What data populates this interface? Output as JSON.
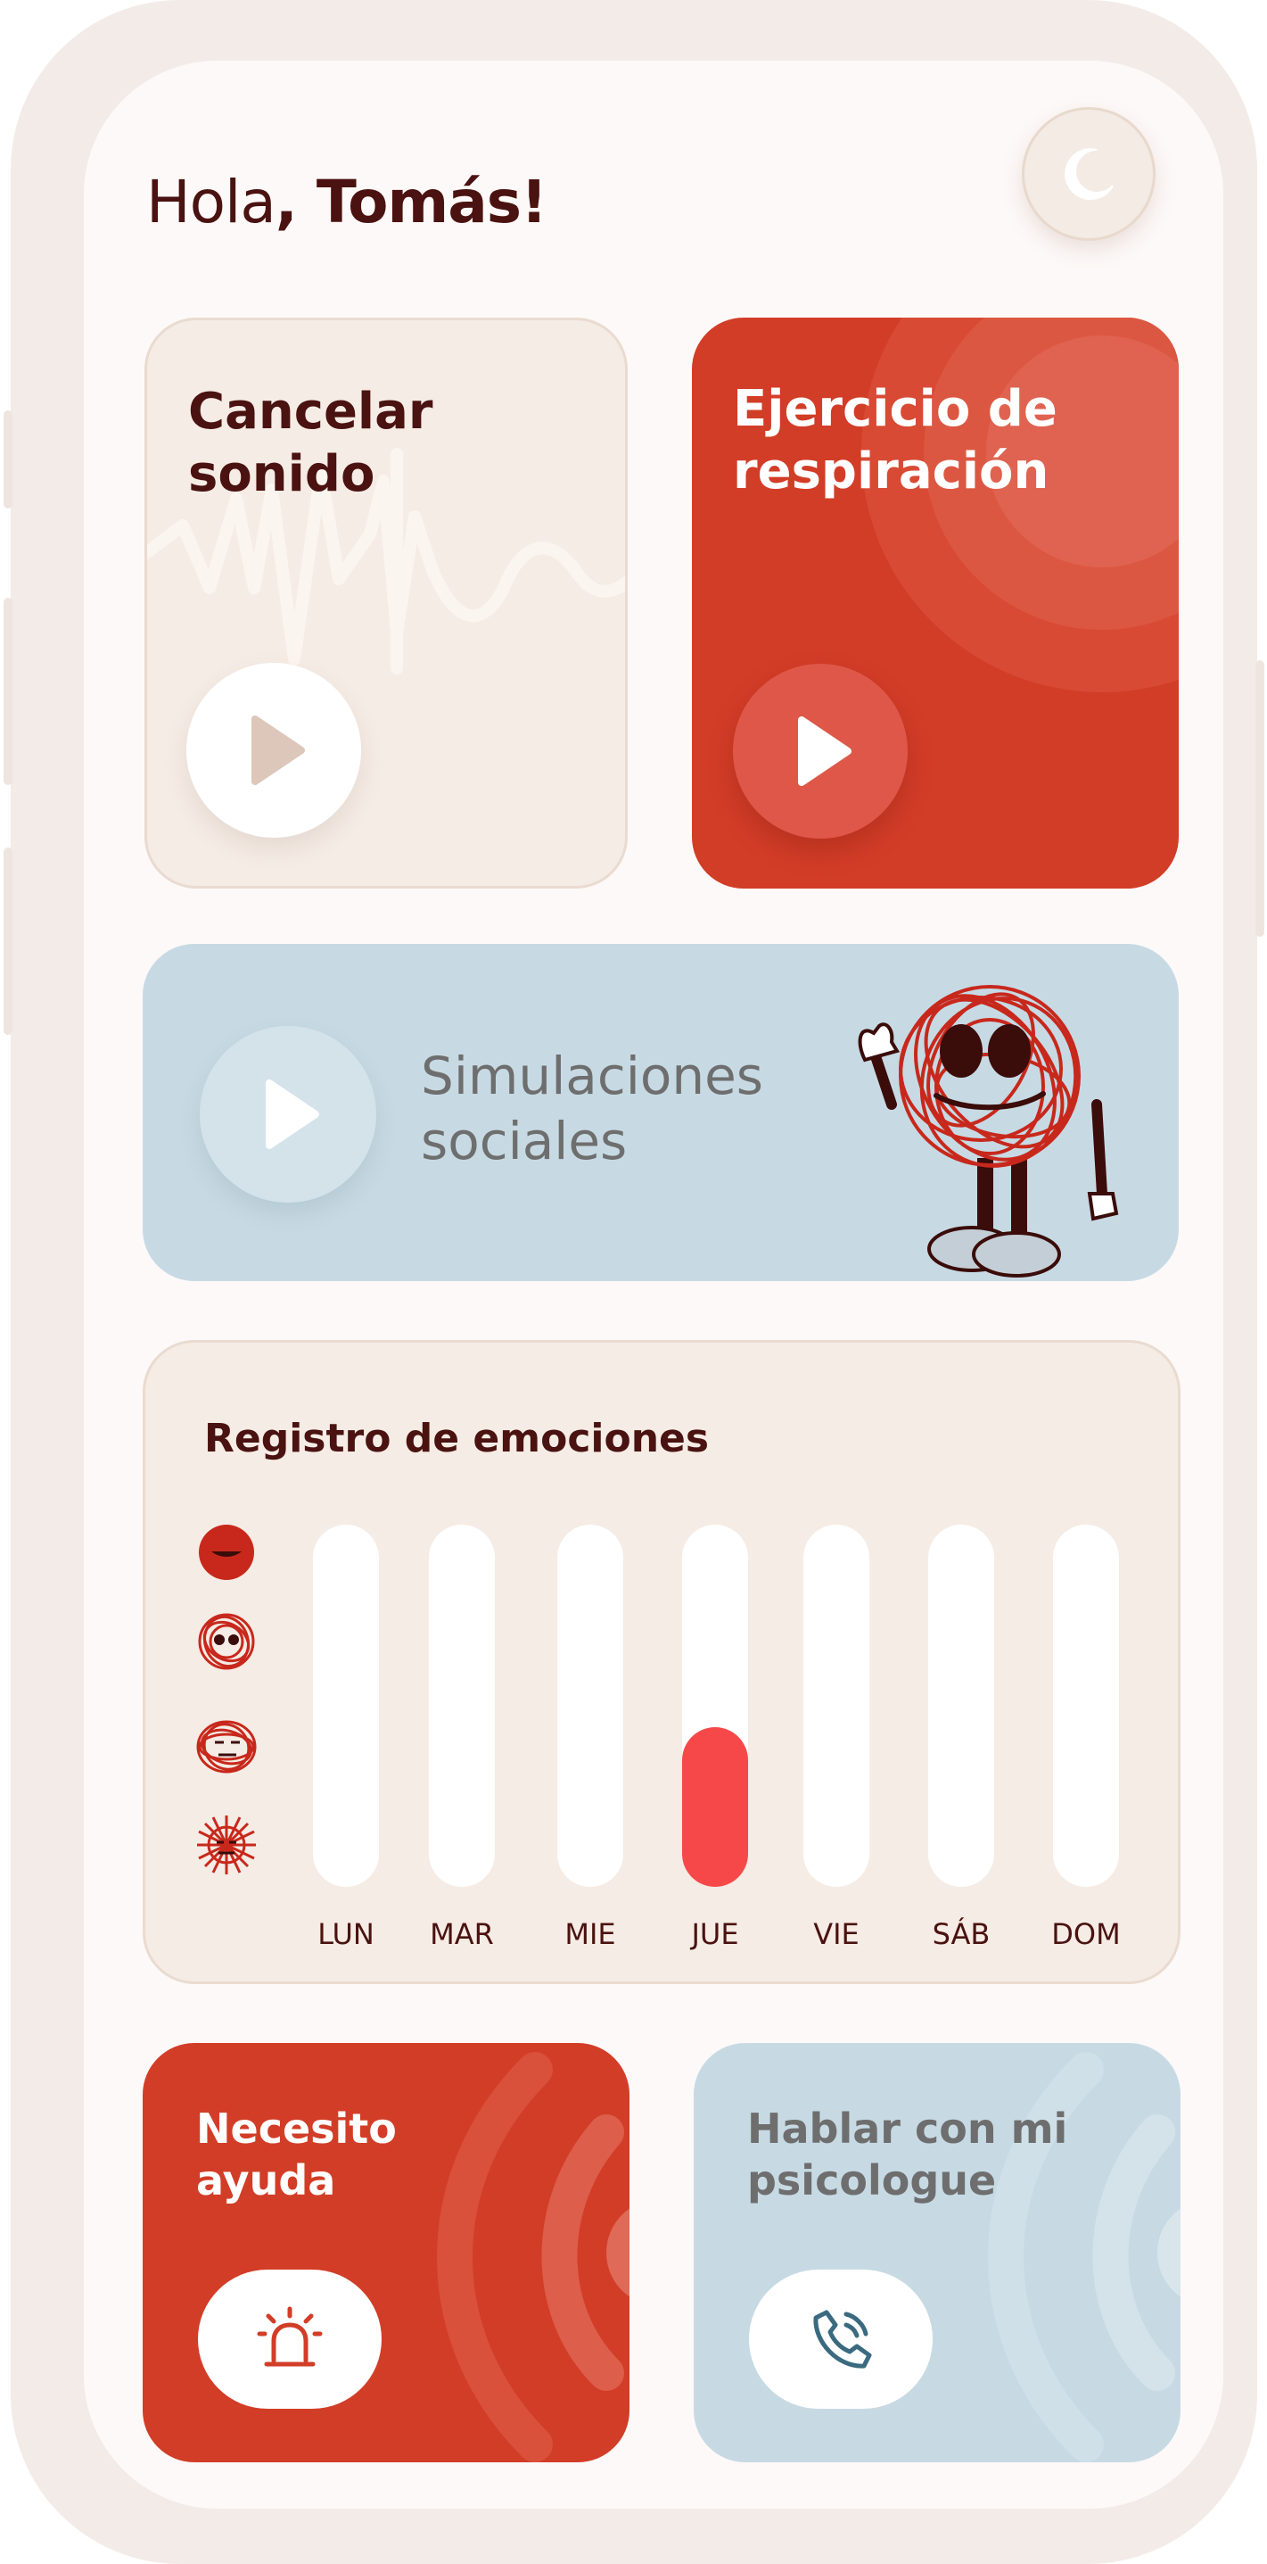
{
  "greeting": {
    "prefix": "Hola",
    "name": ", Tomás!"
  },
  "theme_toggle": {
    "icon": "moon-icon"
  },
  "cards": {
    "cancel_sound": {
      "title": "Cancelar sonido",
      "icon": "play-icon"
    },
    "breathing": {
      "title": "Ejercicio de respiración",
      "icon": "play-icon"
    },
    "social": {
      "title": "Simulaciones sociales",
      "icon": "play-icon"
    },
    "help": {
      "title": "Necesito ayuda",
      "icon": "siren-icon"
    },
    "psychologist": {
      "title": "Hablar con mi psicologue",
      "icon": "phone-icon"
    }
  },
  "emotions": {
    "title": "Registro de emociones",
    "levels": [
      "happy-face-icon",
      "calm-face-icon",
      "uneasy-face-icon",
      "stressed-face-icon"
    ],
    "days": [
      {
        "label": "LUN",
        "level": 0
      },
      {
        "label": "MAR",
        "level": 0
      },
      {
        "label": "MIE",
        "level": 0
      },
      {
        "label": "JUE",
        "level": 0.44
      },
      {
        "label": "VIE",
        "level": 0
      },
      {
        "label": "SÁB",
        "level": 0
      },
      {
        "label": "DOM",
        "level": 0
      }
    ]
  },
  "colors": {
    "accent_red": "#d23d27",
    "light_blue": "#c7dae4",
    "cream": "#f5ece5",
    "dark_text": "#4a1210",
    "emotion_fill": "#f64848"
  }
}
